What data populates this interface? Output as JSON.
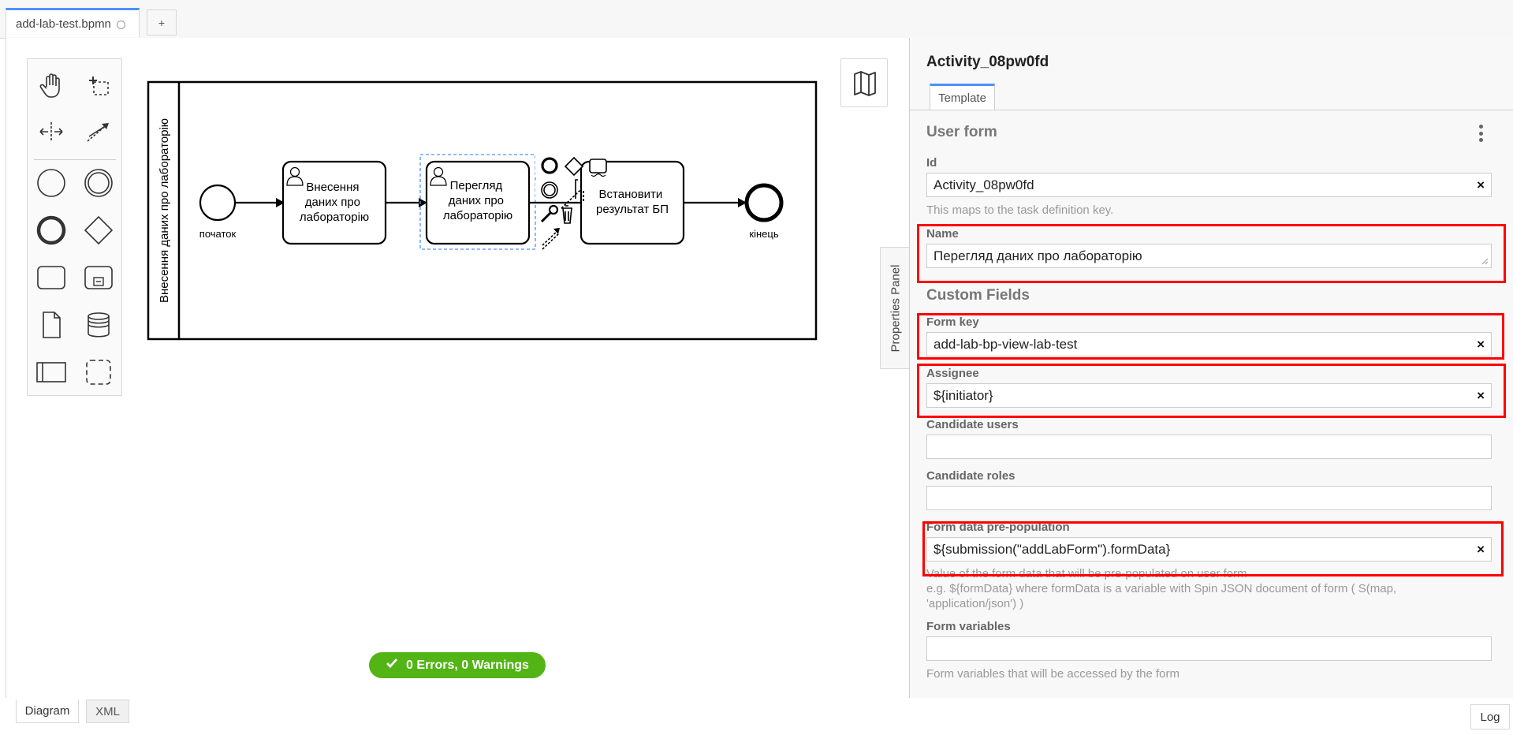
{
  "tabs": {
    "file_name": "add-lab-test.bpmn",
    "add_label": "+"
  },
  "diagram": {
    "pool_label": "Внесення даних про лабораторію",
    "start_label": "початок",
    "end_label": "кінець",
    "task1": [
      "Внесення",
      "даних про",
      "лабораторію"
    ],
    "task2": [
      "Перегляд",
      "даних про",
      "лабораторію"
    ],
    "task3": [
      "Встановити",
      "результат БП"
    ]
  },
  "status": {
    "text": "0 Errors, 0 Warnings",
    "color": "#52b415"
  },
  "bottom_tabs": {
    "diagram": "Diagram",
    "xml": "XML",
    "log": "Log"
  },
  "properties_toggle": "Properties Panel",
  "panel": {
    "element_id": "Activity_08pw0fd",
    "tab": "Template",
    "group_user_form": "User form",
    "id": {
      "label": "Id",
      "value": "Activity_08pw0fd",
      "description": "This maps to the task definition key."
    },
    "name": {
      "label": "Name",
      "value": "Перегляд даних про лабораторію"
    },
    "group_custom": "Custom Fields",
    "form_key": {
      "label": "Form key",
      "value": "add-lab-bp-view-lab-test"
    },
    "assignee": {
      "label": "Assignee",
      "value": "${initiator}"
    },
    "candidate_users": {
      "label": "Candidate users",
      "value": ""
    },
    "candidate_roles": {
      "label": "Candidate roles",
      "value": ""
    },
    "form_data": {
      "label": "Form data pre-population",
      "value": "${submission(\"addLabForm\").formData}",
      "description_1": "Value of the form data that will be pre-populated on user form",
      "description_2": "e.g. ${formData} where formData is a variable with Spin JSON document of form ( S(map,",
      "description_3": "'application/json') )"
    },
    "form_variables": {
      "label": "Form variables",
      "value": "",
      "description": "Form variables that will be accessed by the form"
    }
  },
  "colors": {
    "accent": "#4d90fe",
    "highlight": "#ff0000",
    "selection": "#4d90fe"
  }
}
